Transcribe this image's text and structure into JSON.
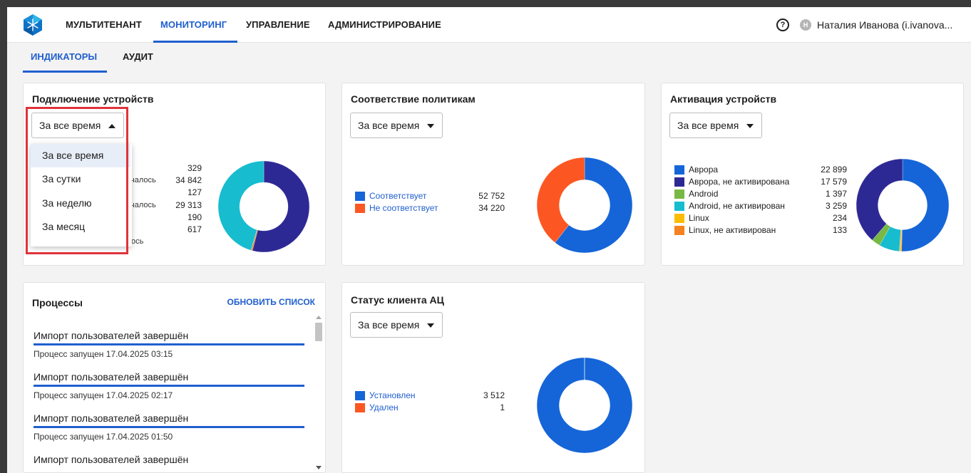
{
  "colors": {
    "accent": "#1f5fcf",
    "highlight": "#e0333a"
  },
  "header": {
    "nav": [
      "МУЛЬТИТЕНАНТ",
      "МОНИТОРИНГ",
      "УПРАВЛЕНИЕ",
      "АДМИНИСТРИРОВАНИЕ"
    ],
    "active_nav": "МОНИТОРИНГ",
    "help_icon": "?",
    "avatar_letter": "Н",
    "user": "Наталия Иванова (i.ivanova..."
  },
  "tabs": {
    "indicators": "ИНДИКАТОРЫ",
    "audit": "АУДИТ",
    "active": "ИНДИКАТОРЫ"
  },
  "device_connection": {
    "title": "Подключение устройств",
    "period": "За все время",
    "dropdown_open": true,
    "options": [
      "За все время",
      "За сутки",
      "За неделю",
      "За месяц"
    ],
    "selected_option": "За все время",
    "values": [
      "329",
      "34 842",
      "127",
      "29 313",
      "190",
      "617"
    ],
    "partial_labels": [
      "ючалось",
      "ючалось",
      "ілось"
    ]
  },
  "policy_compliance": {
    "title": "Соответствие политикам",
    "period": "За все время",
    "legend": [
      {
        "label": "Соответствует",
        "value": "52 752",
        "color": "#1565d8"
      },
      {
        "label": "Не соответствует",
        "value": "34 220",
        "color": "#fc5722"
      }
    ]
  },
  "device_activation": {
    "title": "Активация устройств",
    "period": "За все время",
    "legend": [
      {
        "label": "Аврора",
        "value": "22 899",
        "color": "#1565d8"
      },
      {
        "label": "Аврора, не активирована",
        "value": "17 579",
        "color": "#2d2994"
      },
      {
        "label": "Android",
        "value": "1 397",
        "color": "#77b944"
      },
      {
        "label": "Android, не активирован",
        "value": "3 259",
        "color": "#17bccf"
      },
      {
        "label": "Linux",
        "value": "234",
        "color": "#fbbc04"
      },
      {
        "label": "Linux, не активирован",
        "value": "133",
        "color": "#f58220"
      }
    ]
  },
  "processes": {
    "title": "Процессы",
    "refresh_label": "ОБНОВИТЬ СПИСОК",
    "items": [
      {
        "title": "Импорт пользователей завершён",
        "subtitle": "Процесс запущен 17.04.2025 03:15",
        "progress": 1
      },
      {
        "title": "Импорт пользователей завершён",
        "subtitle": "Процесс запущен 17.04.2025 02:17",
        "progress": 1
      },
      {
        "title": "Импорт пользователей завершён",
        "subtitle": "Процесс запущен 17.04.2025 01:50",
        "progress": 1
      },
      {
        "title": "Импорт пользователей завершён"
      }
    ]
  },
  "ac_client_status": {
    "title": "Статус клиента АЦ",
    "period": "За все время",
    "legend": [
      {
        "label": "Установлен",
        "value": "3 512",
        "color": "#1565d8"
      },
      {
        "label": "Удален",
        "value": "1",
        "color": "#fc5722"
      }
    ]
  },
  "chart_data": [
    {
      "type": "pie",
      "title": "Подключение устройств",
      "slices": [
        {
          "value": 34842,
          "color": "#2d2994"
        },
        {
          "value": 329,
          "color": "#f58220"
        },
        {
          "value": 29313,
          "color": "#17bccf"
        }
      ]
    },
    {
      "type": "pie",
      "title": "Соответствие политикам",
      "slices": [
        {
          "label": "Соответствует",
          "value": 52752,
          "color": "#1565d8"
        },
        {
          "label": "Не соответствует",
          "value": 34220,
          "color": "#fc5722"
        }
      ]
    },
    {
      "type": "pie",
      "title": "Активация устройств",
      "slices": [
        {
          "label": "Аврора",
          "value": 22899,
          "color": "#1565d8"
        },
        {
          "label": "Linux, не активирован",
          "value": 133,
          "color": "#f58220"
        },
        {
          "label": "Linux",
          "value": 234,
          "color": "#fbbc04"
        },
        {
          "label": "Android, не активирован",
          "value": 3259,
          "color": "#17bccf"
        },
        {
          "label": "Android",
          "value": 1397,
          "color": "#77b944"
        },
        {
          "label": "Аврора, не активирована",
          "value": 17579,
          "color": "#2d2994"
        }
      ]
    },
    {
      "type": "pie",
      "title": "Статус клиента АЦ",
      "slices": [
        {
          "label": "Установлен",
          "value": 3512,
          "color": "#1565d8"
        },
        {
          "label": "Удален",
          "value": 1,
          "color": "#fc5722"
        }
      ]
    }
  ]
}
